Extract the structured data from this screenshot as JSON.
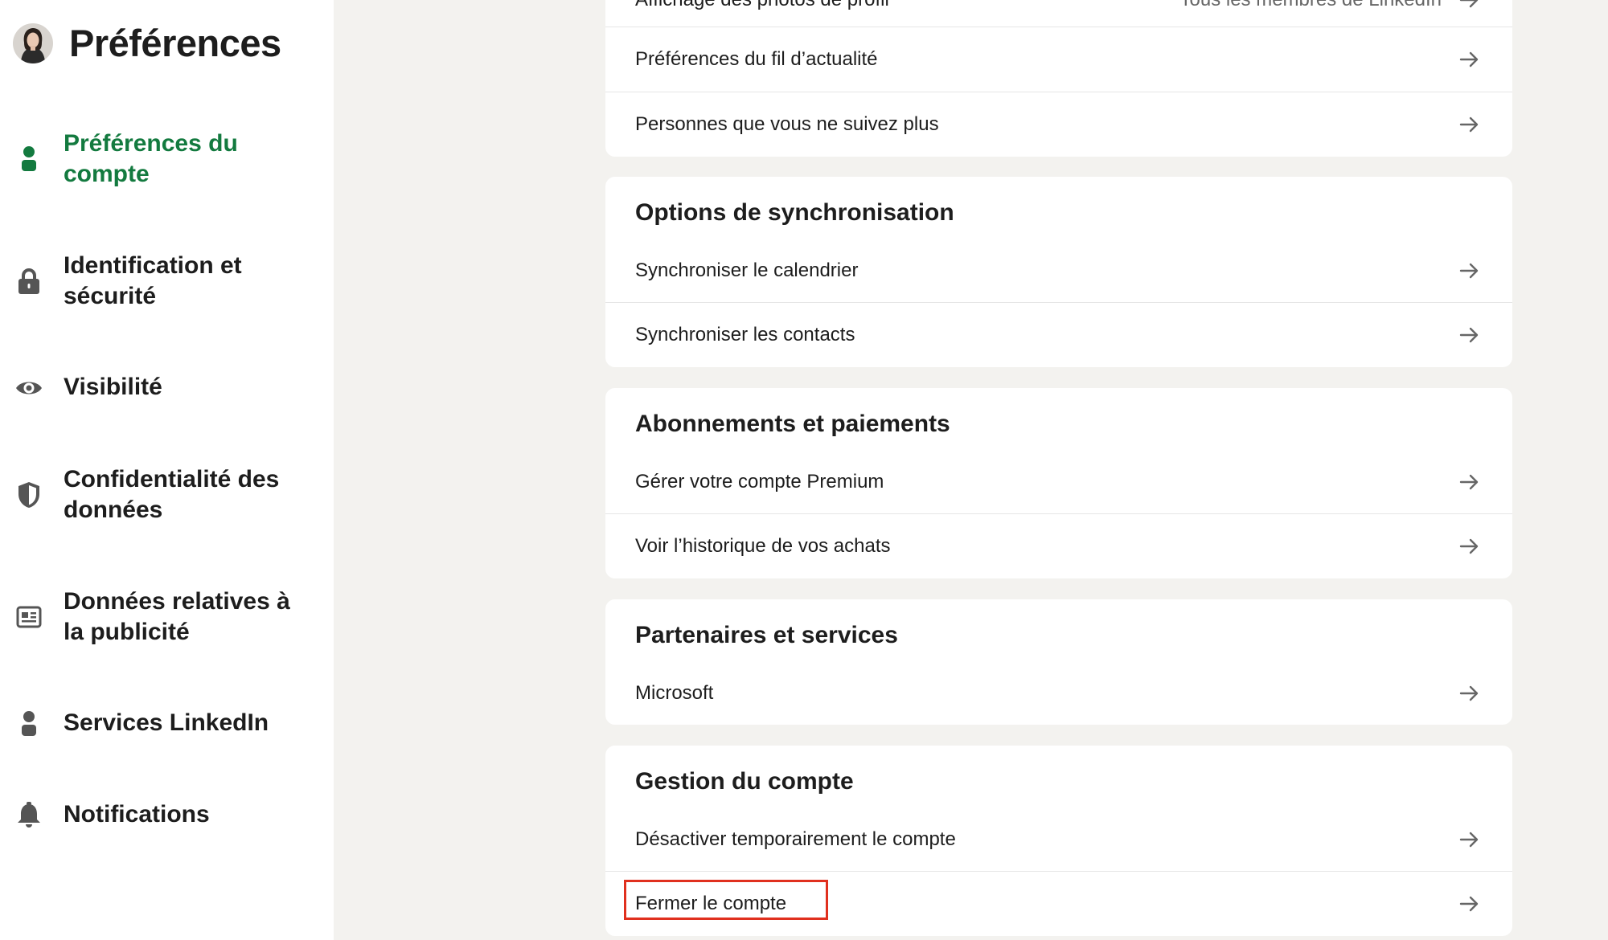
{
  "sidebar": {
    "title": "Préférences",
    "items": [
      {
        "label": "Préférences du compte",
        "icon": "person-icon",
        "active": true
      },
      {
        "label": "Identification et sécurité",
        "icon": "lock-icon",
        "active": false
      },
      {
        "label": "Visibilité",
        "icon": "eye-icon",
        "active": false
      },
      {
        "label": "Confidentialité des données",
        "icon": "shield-icon",
        "active": false
      },
      {
        "label": "Données relatives à la publicité",
        "icon": "newspaper-icon",
        "active": false
      },
      {
        "label": "Services LinkedIn",
        "icon": "person-icon",
        "active": false
      },
      {
        "label": "Notifications",
        "icon": "bell-icon",
        "active": false
      }
    ]
  },
  "sections": {
    "general": {
      "rows": [
        {
          "label": "Affichage des photos de profil",
          "value": "Tous les membres de LinkedIn"
        },
        {
          "label": "Préférences du fil d’actualité"
        },
        {
          "label": "Personnes que vous ne suivez plus"
        }
      ]
    },
    "sync": {
      "title": "Options de synchronisation",
      "rows": [
        {
          "label": "Synchroniser le calendrier"
        },
        {
          "label": "Synchroniser les contacts"
        }
      ]
    },
    "billing": {
      "title": "Abonnements et paiements",
      "rows": [
        {
          "label": "Gérer votre compte Premium"
        },
        {
          "label": "Voir l’historique de vos achats"
        }
      ]
    },
    "partners": {
      "title": "Partenaires et services",
      "rows": [
        {
          "label": "Microsoft"
        }
      ]
    },
    "account": {
      "title": "Gestion du compte",
      "rows": [
        {
          "label": "Désactiver temporairement le compte"
        },
        {
          "label": "Fermer le compte"
        }
      ]
    }
  },
  "colors": {
    "accent": "#137a3f",
    "highlight": "#e0301e",
    "background": "#f3f2ef"
  }
}
